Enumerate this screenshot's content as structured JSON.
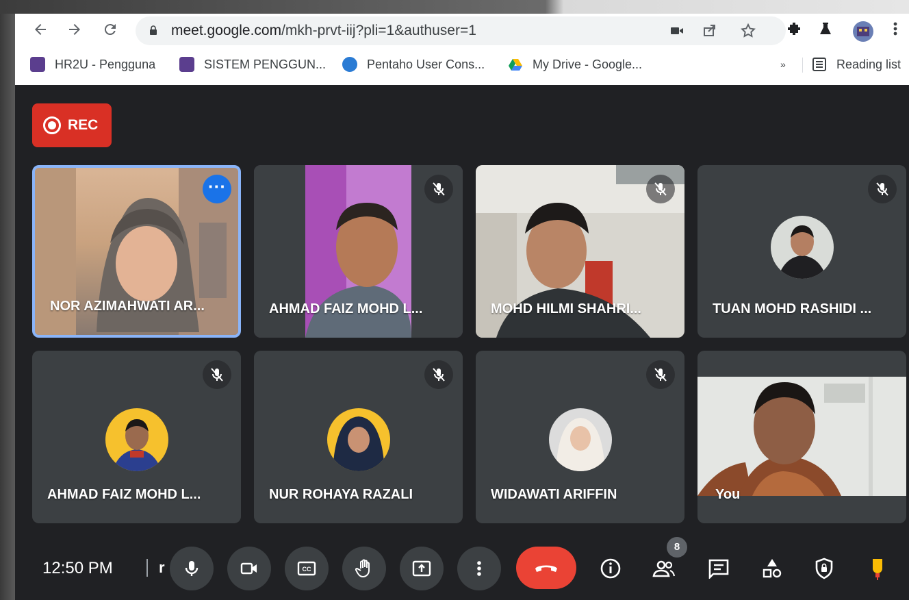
{
  "browser": {
    "url_host": "meet.google.com",
    "url_path": "/mkh-prvt-iij?pli=1&authuser=1",
    "bookmarks": [
      {
        "label": "HR2U - Pengguna"
      },
      {
        "label": "SISTEM PENGGUN..."
      },
      {
        "label": "Pentaho User Cons..."
      },
      {
        "label": "My Drive - Google..."
      }
    ],
    "overflow_label": "»",
    "reading_list": "Reading list"
  },
  "recording": {
    "label": "REC",
    "color": "#d93025"
  },
  "participants": [
    {
      "name": "NOR AZIMAHWATI AR...",
      "muted": false,
      "active": true
    },
    {
      "name": "AHMAD FAIZ MOHD L...",
      "muted": true
    },
    {
      "name": "MOHD HILMI SHAHRI...",
      "muted": true
    },
    {
      "name": "TUAN MOHD RASHIDI ...",
      "muted": true
    },
    {
      "name": "AHMAD FAIZ MOHD L...",
      "muted": true
    },
    {
      "name": "NUR ROHAYA RAZALI",
      "muted": true
    },
    {
      "name": "WIDAWATI ARIFFIN",
      "muted": true
    },
    {
      "name": "You",
      "muted": false
    }
  ],
  "controls": {
    "time": "12:50 PM",
    "meeting_code": "r",
    "participant_count": "8"
  },
  "colors": {
    "accent": "#8ab4f8",
    "end_call": "#ea4335",
    "background": "#202124",
    "tile": "#3c4043"
  }
}
